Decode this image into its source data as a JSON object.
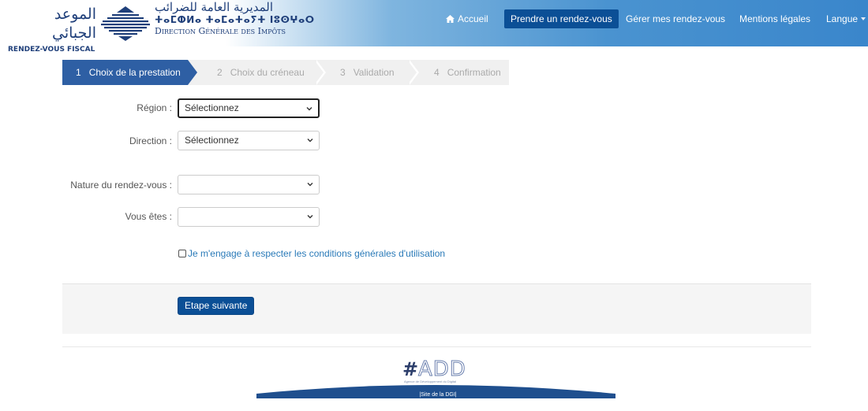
{
  "header": {
    "logo_arabic": "الموعد الجبائي",
    "logo_label": "RENDEZ-VOUS FISCAL",
    "dgi_arabic": "المديرية العامة للضرائب",
    "dgi_tifinagh": "ⵜⴰⵎⵀⵍⴰ ⵜⴰⵎⴰⵜⴰⵢⵜ ⵏⵓⵙⵖⴰⵔ",
    "dgi_french": "Direction Générale des Impôts"
  },
  "nav": {
    "home_label": "Accueil",
    "book_label": "Prendre un rendez-vous",
    "manage_label": "Gérer mes rendez-vous",
    "legal_label": "Mentions légales",
    "language_label": "Langue"
  },
  "steps": [
    {
      "num": "1",
      "label": "Choix de la prestation",
      "active": true
    },
    {
      "num": "2",
      "label": "Choix du créneau",
      "active": false
    },
    {
      "num": "3",
      "label": "Validation",
      "active": false
    },
    {
      "num": "4",
      "label": "Confirmation",
      "active": false
    }
  ],
  "form": {
    "region_label": "Région :",
    "region_value": "Sélectionnez",
    "direction_label": "Direction :",
    "direction_value": "Sélectionnez",
    "nature_label": "Nature du rendez-vous :",
    "nature_value": "",
    "status_label": "Vous êtes :",
    "status_value": "",
    "terms_label": "Je m'engage à respecter les conditions générales d'utilisation",
    "next_button": "Etape suivante"
  },
  "footer": {
    "add_hash": "#",
    "add_text": "ADD",
    "add_tagline": "Agence de Développement du Digital",
    "dgi_link": "|Site de la DGI|"
  },
  "colors": {
    "primary": "#0b4f96",
    "step_active": "#2e5fa4",
    "link": "#2a7ab8"
  }
}
